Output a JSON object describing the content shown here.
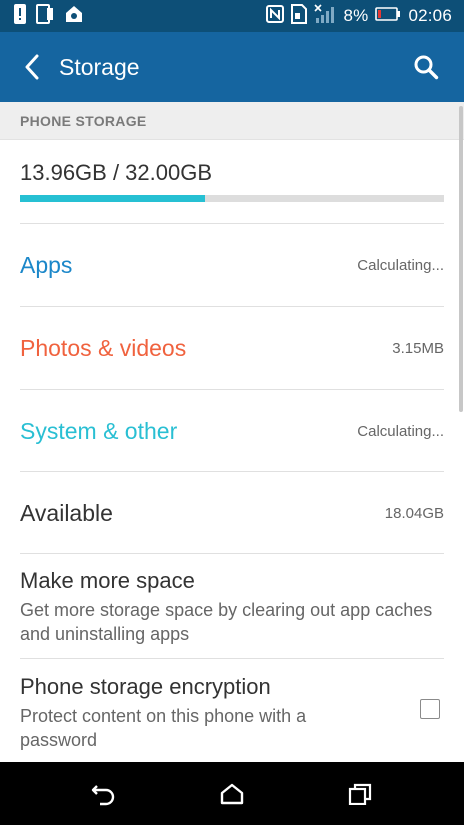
{
  "status_bar": {
    "battery_percent": "8%",
    "time": "02:06"
  },
  "app_bar": {
    "title": "Storage"
  },
  "section": {
    "header": "PHONE STORAGE"
  },
  "usage": {
    "text": "13.96GB / 32.00GB",
    "used_fraction": 0.436
  },
  "categories": [
    {
      "label": "Apps",
      "value": "Calculating...",
      "color": "#1b87c9"
    },
    {
      "label": "Photos & videos",
      "value": "3.15MB",
      "color": "#f0623e"
    },
    {
      "label": "System & other",
      "value": "Calculating...",
      "color": "#29bfd3"
    },
    {
      "label": "Available",
      "value": "18.04GB",
      "color": "#333333"
    }
  ],
  "make_space": {
    "title": "Make more space",
    "subtitle": "Get more storage space by clearing out app caches and uninstalling apps"
  },
  "encryption": {
    "title": "Phone storage encryption",
    "subtitle": "Protect content on this phone with a password",
    "checked": false
  },
  "icons": {
    "status_left": [
      "alert-icon",
      "phone-icon",
      "location-icon"
    ],
    "status_right": [
      "nfc-icon",
      "sim-icon",
      "signal-icon",
      "battery-icon"
    ],
    "nav": [
      "back-icon",
      "home-icon",
      "recents-icon"
    ]
  }
}
